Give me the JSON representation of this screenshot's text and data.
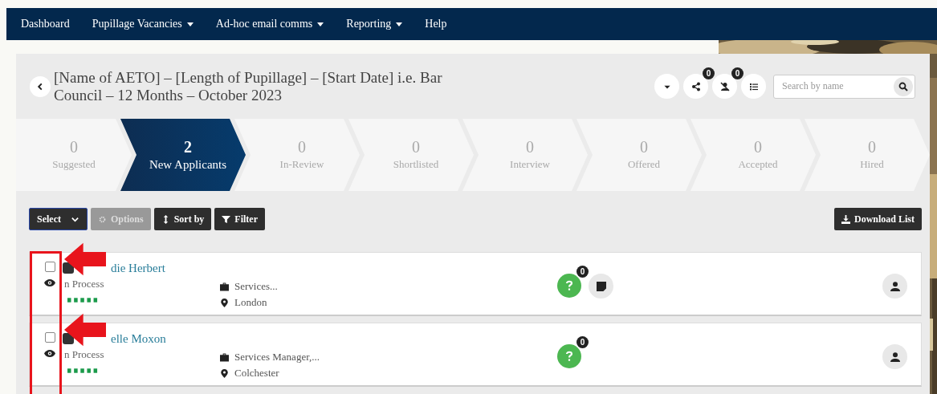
{
  "nav": [
    {
      "label": "Dashboard",
      "dropdown": false
    },
    {
      "label": "Pupillage Vacancies",
      "dropdown": true
    },
    {
      "label": "Ad-hoc email comms",
      "dropdown": true
    },
    {
      "label": "Reporting",
      "dropdown": true
    },
    {
      "label": "Help",
      "dropdown": false
    }
  ],
  "header": {
    "title": "[Name of AETO] – [Length of Pupillage] – [Start Date] i.e. Bar Council – 12 Months – October 2023",
    "share_count": "0",
    "hidden_count": "0",
    "search": {
      "placeholder": "Search by name"
    }
  },
  "stages": [
    {
      "count": "0",
      "label": "Suggested",
      "selected": false
    },
    {
      "count": "2",
      "label": "New Applicants",
      "selected": true
    },
    {
      "count": "0",
      "label": "In-Review",
      "selected": false
    },
    {
      "count": "0",
      "label": "Shortlisted",
      "selected": false
    },
    {
      "count": "0",
      "label": "Interview",
      "selected": false
    },
    {
      "count": "0",
      "label": "Offered",
      "selected": false
    },
    {
      "count": "0",
      "label": "Accepted",
      "selected": false
    },
    {
      "count": "0",
      "label": "Hired",
      "selected": false
    }
  ],
  "toolbar": [
    {
      "label": "Select",
      "kind": "select",
      "disabled": false
    },
    {
      "label": "Options",
      "kind": "options",
      "disabled": true
    },
    {
      "label": "Sort by",
      "kind": "sort",
      "disabled": false
    },
    {
      "label": "Filter",
      "kind": "filter",
      "disabled": false
    }
  ],
  "download": {
    "label": "Download List"
  },
  "applicants": [
    {
      "name": "die Herbert",
      "status": "n Process",
      "job": "Services...",
      "location": "London",
      "checked": false,
      "question_count": "0",
      "has_note": true
    },
    {
      "name": "elle Moxon",
      "status": "n Process",
      "job": "Services Manager,...",
      "location": "Colchester",
      "checked": false,
      "question_count": "0",
      "has_note": false
    }
  ]
}
